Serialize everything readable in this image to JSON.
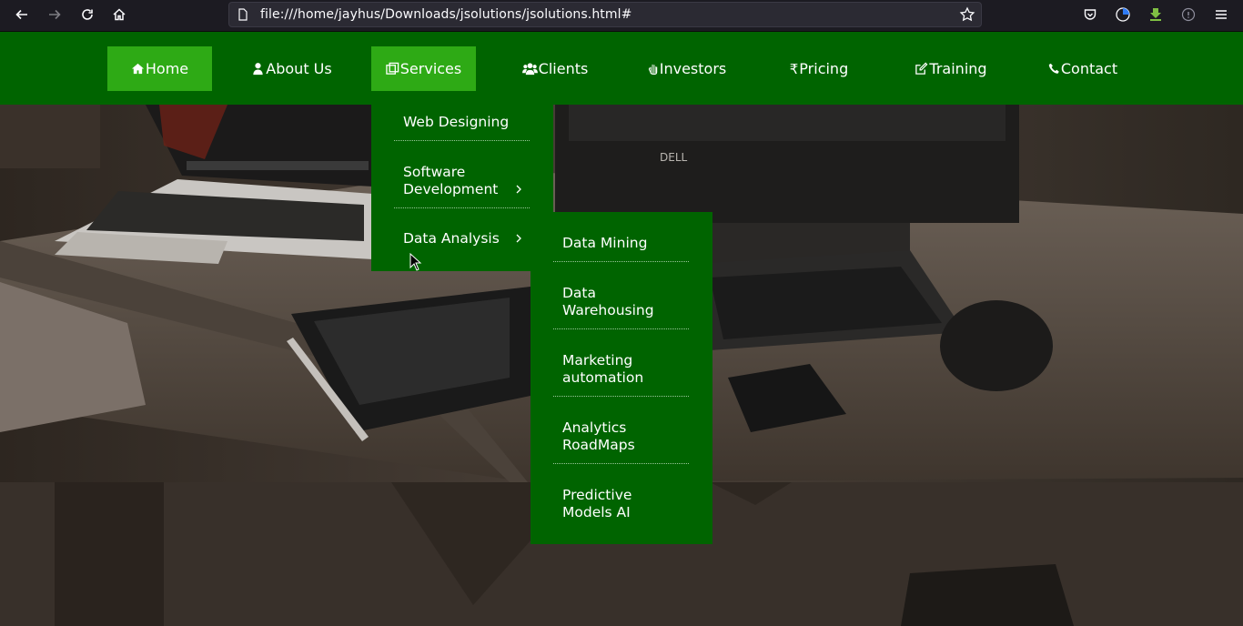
{
  "browser": {
    "url": "file:///home/jayhus/Downloads/jsolutions/jsolutions.html#",
    "icons": [
      "back-icon",
      "forward-icon",
      "reload-icon",
      "home-icon",
      "page-icon",
      "bookmark-star-icon",
      "pocket-icon",
      "account-icon",
      "download-icon",
      "extension-icon",
      "menu-icon"
    ]
  },
  "nav": {
    "items": [
      {
        "label": "Home",
        "icon": "home-icon"
      },
      {
        "label": "About Us",
        "icon": "user-icon"
      },
      {
        "label": "Services",
        "icon": "clone-icon"
      },
      {
        "label": "Clients",
        "icon": "users-icon"
      },
      {
        "label": "Investors",
        "icon": "hand-icon"
      },
      {
        "label": "Pricing",
        "icon": "rupee-icon",
        "icon_glyph": "₹"
      },
      {
        "label": "Training",
        "icon": "edit-icon"
      },
      {
        "label": "Contact",
        "icon": "phone-icon"
      }
    ],
    "colors": {
      "background": "#006400",
      "active": "#2eaa15"
    }
  },
  "services_menu": {
    "items": [
      {
        "label": "Web Designing"
      },
      {
        "label": "Software Development",
        "has_submenu": true
      },
      {
        "label": "Data Analysis",
        "has_submenu": true
      }
    ]
  },
  "data_analysis_menu": {
    "items": [
      {
        "label": "Data Mining"
      },
      {
        "label": "Data Warehousing"
      },
      {
        "label": "Marketing automation"
      },
      {
        "label": "Analytics RoadMaps"
      },
      {
        "label": "Predictive Models AI"
      }
    ]
  }
}
